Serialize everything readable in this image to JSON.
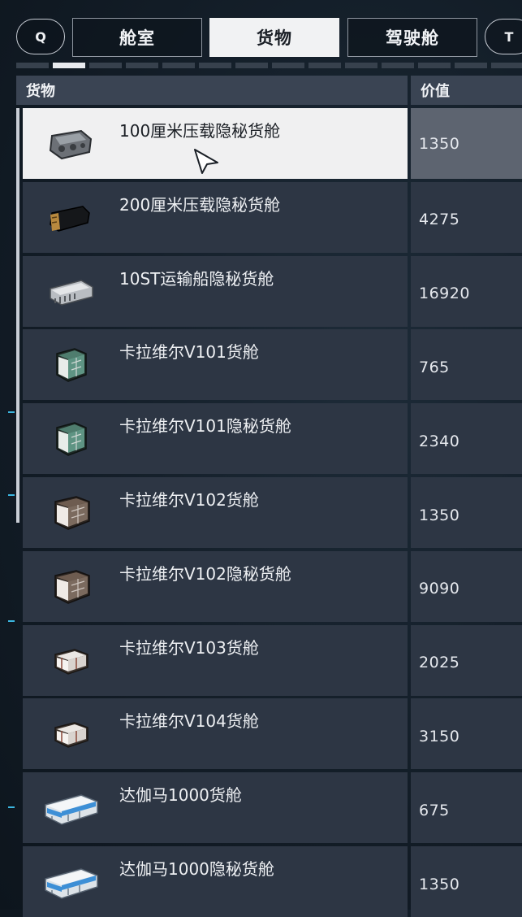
{
  "tabs": {
    "left_key": "Q",
    "right_key": "T",
    "items": [
      {
        "label": "舱室"
      },
      {
        "label": "货物"
      },
      {
        "label": "驾驶舱"
      }
    ],
    "active": "货物"
  },
  "table": {
    "header_name": "货物",
    "header_value": "价值",
    "rows": [
      {
        "name": "100厘米压载隐秘货舱",
        "value": "1350",
        "icon": "ballast-cargo-pod-icon"
      },
      {
        "name": "200厘米压载隐秘货舱",
        "value": "4275",
        "icon": "black-cargo-pod-icon"
      },
      {
        "name": "10ST运输船隐秘货舱",
        "value": "16920",
        "icon": "transport-cargo-pod-icon"
      },
      {
        "name": "卡拉维尔V101货舱",
        "value": "765",
        "icon": "green-cargo-crate-icon"
      },
      {
        "name": "卡拉维尔V101隐秘货舱",
        "value": "2340",
        "icon": "green-cargo-crate-icon"
      },
      {
        "name": "卡拉维尔V102货舱",
        "value": "1350",
        "icon": "white-cargo-crate-icon"
      },
      {
        "name": "卡拉维尔V102隐秘货舱",
        "value": "9090",
        "icon": "white-cargo-crate-icon"
      },
      {
        "name": "卡拉维尔V103货舱",
        "value": "2025",
        "icon": "small-white-crate-icon"
      },
      {
        "name": "卡拉维尔V104货舱",
        "value": "3150",
        "icon": "small-white-crate-icon"
      },
      {
        "name": "达伽马1000货舱",
        "value": "675",
        "icon": "blue-stripe-container-icon"
      },
      {
        "name": "达伽马1000隐秘货舱",
        "value": "1350",
        "icon": "blue-stripe-container-icon"
      }
    ]
  },
  "colors": {
    "row_bg": "#2d3644",
    "selected_row_bg": "#f0f0f1",
    "header_bg": "#3a4453",
    "accent": "#3bb6e0"
  }
}
